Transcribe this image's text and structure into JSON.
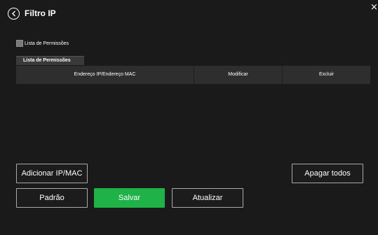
{
  "header": {
    "title": "Filtro IP",
    "back_icon": "chevron-left-circle-icon",
    "close_label": "×"
  },
  "permissions": {
    "checkbox_label": "Lista de Permissões",
    "checked": false,
    "tab_label": "Lista de Permissões"
  },
  "table": {
    "columns": [
      "Endereço IP/Endereço MAC",
      "Modificar",
      "Excluir"
    ],
    "rows": []
  },
  "buttons": {
    "add": "Adicionar IP/MAC",
    "clear_all": "Apagar todos",
    "default": "Padrão",
    "save": "Salvar",
    "refresh": "Atualizar"
  },
  "colors": {
    "background": "#1a1a1a",
    "save_accent": "#1eb249",
    "header_row": "#2e2e2e"
  }
}
